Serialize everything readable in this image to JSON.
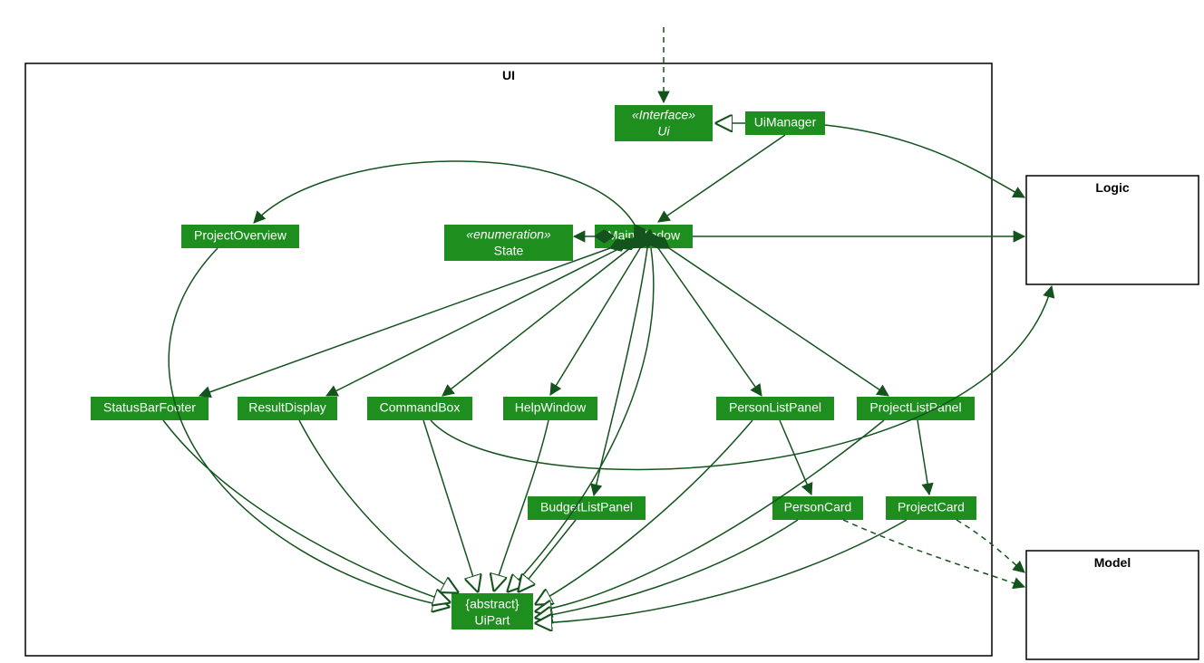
{
  "packages": {
    "ui": {
      "title": "UI"
    },
    "logic": {
      "title": "Logic"
    },
    "model": {
      "title": "Model"
    }
  },
  "nodes": {
    "interfaceUi": {
      "stereotype": "«Interface»",
      "name": "Ui"
    },
    "uiManager": {
      "name": "UiManager"
    },
    "mainWindow": {
      "name": "MainWindow"
    },
    "enumState": {
      "stereotype": "«enumeration»",
      "name": "State"
    },
    "projectOverview": {
      "name": "ProjectOverview"
    },
    "statusBarFooter": {
      "name": "StatusBarFooter"
    },
    "resultDisplay": {
      "name": "ResultDisplay"
    },
    "commandBox": {
      "name": "CommandBox"
    },
    "helpWindow": {
      "name": "HelpWindow"
    },
    "personListPanel": {
      "name": "PersonListPanel"
    },
    "projectListPanel": {
      "name": "ProjectListPanel"
    },
    "budgetListPanel": {
      "name": "BudgetListPanel"
    },
    "personCard": {
      "name": "PersonCard"
    },
    "projectCard": {
      "name": "ProjectCard"
    },
    "uiPart": {
      "stereotype": "{abstract}",
      "name": "UiPart"
    }
  },
  "colors": {
    "node": "#1e8e1e",
    "edge": "#14531d"
  },
  "diagram_meta": {
    "edges": [
      {
        "from": "external-top",
        "to": "interfaceUi",
        "type": "dependency-dashed"
      },
      {
        "from": "uiManager",
        "to": "interfaceUi",
        "type": "realization"
      },
      {
        "from": "uiManager",
        "to": "mainWindow",
        "type": "association"
      },
      {
        "from": "uiManager",
        "to": "logic",
        "type": "association"
      },
      {
        "from": "mainWindow",
        "to": "logic",
        "type": "association"
      },
      {
        "from": "mainWindow",
        "to": "enumState",
        "type": "composition"
      },
      {
        "from": "mainWindow",
        "to": "projectOverview",
        "type": "composition"
      },
      {
        "from": "mainWindow",
        "to": "statusBarFooter",
        "type": "composition"
      },
      {
        "from": "mainWindow",
        "to": "resultDisplay",
        "type": "composition"
      },
      {
        "from": "mainWindow",
        "to": "commandBox",
        "type": "composition"
      },
      {
        "from": "mainWindow",
        "to": "helpWindow",
        "type": "composition"
      },
      {
        "from": "mainWindow",
        "to": "budgetListPanel",
        "type": "composition"
      },
      {
        "from": "mainWindow",
        "to": "personListPanel",
        "type": "composition"
      },
      {
        "from": "mainWindow",
        "to": "projectListPanel",
        "type": "composition"
      },
      {
        "from": "mainWindow",
        "to": "uiPart",
        "type": "generalization"
      },
      {
        "from": "projectOverview",
        "to": "uiPart",
        "type": "generalization"
      },
      {
        "from": "statusBarFooter",
        "to": "uiPart",
        "type": "generalization"
      },
      {
        "from": "resultDisplay",
        "to": "uiPart",
        "type": "generalization"
      },
      {
        "from": "commandBox",
        "to": "uiPart",
        "type": "generalization"
      },
      {
        "from": "helpWindow",
        "to": "uiPart",
        "type": "generalization"
      },
      {
        "from": "budgetListPanel",
        "to": "uiPart",
        "type": "generalization"
      },
      {
        "from": "personListPanel",
        "to": "uiPart",
        "type": "generalization"
      },
      {
        "from": "projectListPanel",
        "to": "uiPart",
        "type": "generalization"
      },
      {
        "from": "personCard",
        "to": "uiPart",
        "type": "generalization"
      },
      {
        "from": "projectCard",
        "to": "uiPart",
        "type": "generalization"
      },
      {
        "from": "personListPanel",
        "to": "personCard",
        "type": "association"
      },
      {
        "from": "projectListPanel",
        "to": "projectCard",
        "type": "association"
      },
      {
        "from": "personCard",
        "to": "model",
        "type": "dependency-dashed"
      },
      {
        "from": "projectCard",
        "to": "model",
        "type": "dependency-dashed"
      },
      {
        "from": "commandBox",
        "to": "logic",
        "type": "association-curved"
      }
    ]
  }
}
